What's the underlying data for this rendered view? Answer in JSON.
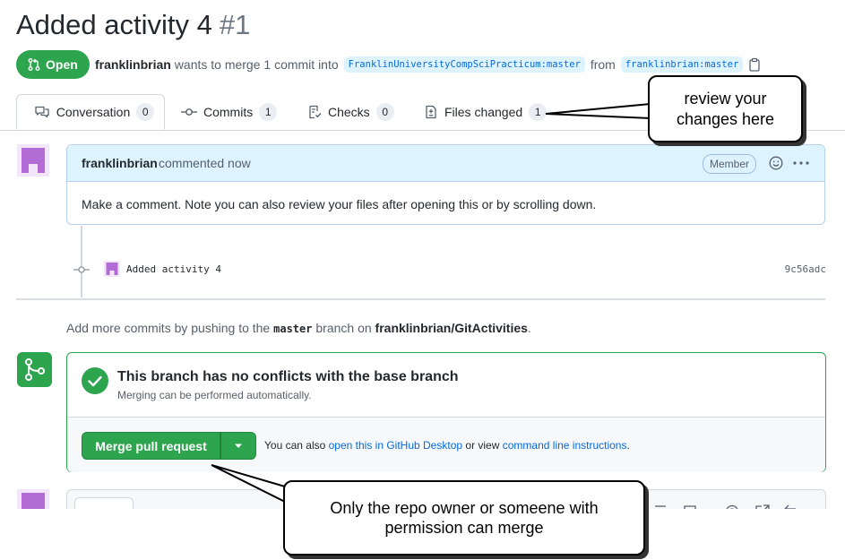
{
  "pr": {
    "title": "Added activity 4",
    "number": "#1",
    "state": "Open",
    "author": "franklinbrian",
    "merge_text": "wants to merge 1 commit into",
    "base_branch": "FranklinUniversityCompSciPracticum:master",
    "from_text": "from",
    "head_branch": "franklinbrian:master"
  },
  "tabs": [
    {
      "label": "Conversation",
      "count": "0"
    },
    {
      "label": "Commits",
      "count": "1"
    },
    {
      "label": "Checks",
      "count": "0"
    },
    {
      "label": "Files changed",
      "count": "1"
    }
  ],
  "comment": {
    "author": "franklinbrian",
    "time": "commented now",
    "badge": "Member",
    "body": "Make a comment. Note you can also review your files after opening this or by scrolling down."
  },
  "commit": {
    "message": "Added activity 4",
    "sha": "9c56adc"
  },
  "hint": {
    "prefix": "Add more commits by pushing to the",
    "branch": "master",
    "middle": "branch on",
    "repo": "franklinbrian/GitActivities",
    "suffix": "."
  },
  "merge": {
    "status_title": "This branch has no conflicts with the base branch",
    "status_sub": "Merging can be performed automatically.",
    "button": "Merge pull request",
    "alt_prefix": "You can also",
    "alt_link1": "open this in GitHub Desktop",
    "alt_middle": "or view",
    "alt_link2": "command line instructions",
    "alt_suffix": "."
  },
  "callouts": {
    "review": "review your changes here",
    "merge": "Only the repo owner or someene with permission can merge"
  },
  "colors": {
    "green": "#2da44e",
    "link": "#0969da",
    "avatar": "#b36bd6"
  }
}
